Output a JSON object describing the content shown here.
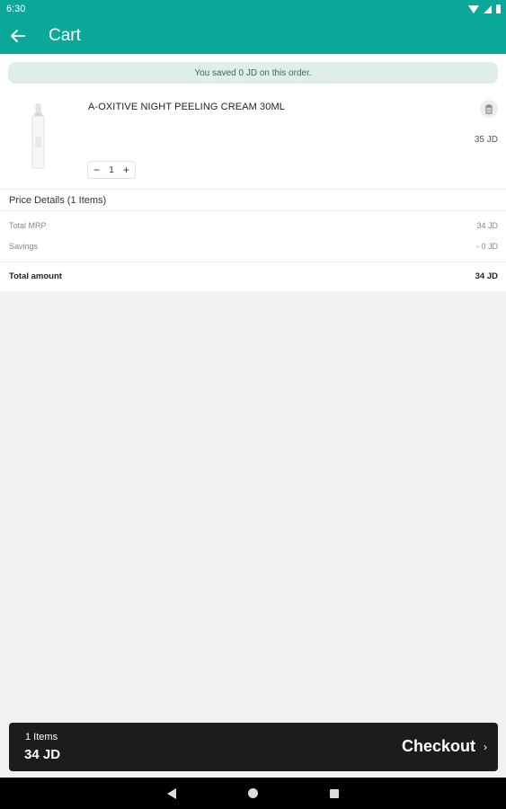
{
  "status_bar": {
    "time": "6:30"
  },
  "app_bar": {
    "title": "Cart"
  },
  "savings_banner": {
    "text": "You saved 0 JD on this order."
  },
  "cart_item": {
    "name": "A-OXITIVE NIGHT PEELING CREAM 30ML",
    "price": "35 JD",
    "quantity": "1",
    "minus": "−",
    "plus": "+"
  },
  "price_details": {
    "header": "Price Details (1 Items)",
    "total_mrp_label": "Total MRP",
    "total_mrp_value": "34 JD",
    "savings_label": "Savings",
    "savings_value": "- 0 JD",
    "total_label": "Total amount",
    "total_value": "34 JD"
  },
  "bottom_bar": {
    "items_count": "1 Items",
    "total": "34 JD",
    "checkout_label": "Checkout",
    "checkout_chevron": "›"
  },
  "icons": {
    "back": "arrow-left",
    "delete": "trash",
    "nav_back": "triangle-left",
    "nav_home": "circle",
    "nav_recents": "square"
  },
  "colors": {
    "primary": "#0aa898",
    "banner_bg": "#dfeee9",
    "checkout_bar": "#1c1c1c"
  }
}
